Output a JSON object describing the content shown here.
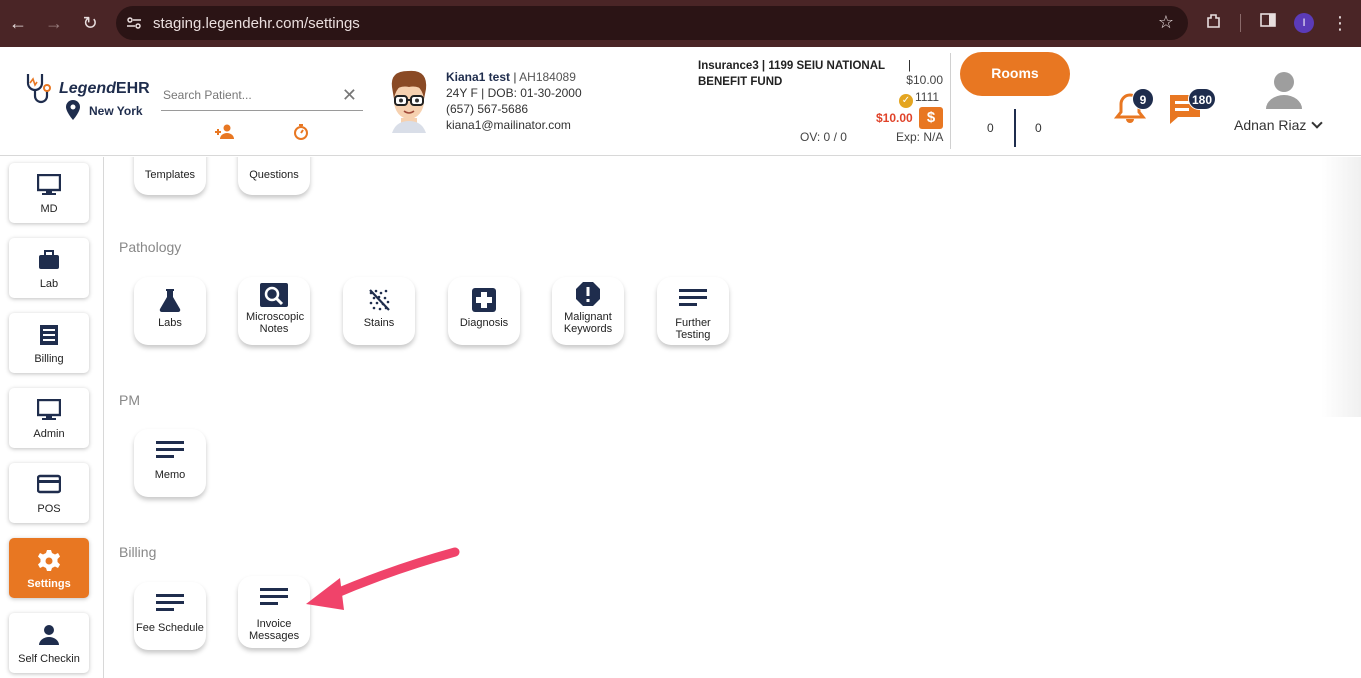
{
  "browser": {
    "url": "staging.legendehr.com/settings",
    "profile_initial": "I"
  },
  "header": {
    "brand": "LegendEHR",
    "brand_a": "Legend",
    "brand_b": "EHR",
    "location": "New York",
    "search_placeholder": "Search Patient...",
    "patient": {
      "name": "Kiana1 test",
      "id": "AH184089",
      "line2": "24Y F | DOB: 01-30-2000",
      "phone": "(657) 567-5686",
      "email": "kiana1@mailinator.com"
    },
    "insurance": {
      "line1": "Insurance3 | 1199 SEIU NATIONAL",
      "line2": "BENEFIT FUND",
      "pipe": "|"
    },
    "balance": "$10.00",
    "coins": "1111",
    "due": "$10.00",
    "dollar_sign": "$",
    "ov": "OV: 0 / 0",
    "exp": "Exp: N/A",
    "rooms_label": "Rooms",
    "count_left": "0",
    "count_right": "0",
    "notifications": "9",
    "messages": "180",
    "user_name": "Adnan Riaz"
  },
  "sidebar": {
    "items": [
      {
        "label": "MD"
      },
      {
        "label": "Lab"
      },
      {
        "label": "Billing"
      },
      {
        "label": "Admin"
      },
      {
        "label": "POS"
      },
      {
        "label": "Settings"
      },
      {
        "label": "Self Checkin"
      }
    ]
  },
  "main": {
    "top_cards": [
      "Templates",
      "Questions"
    ],
    "pathology": {
      "title": "Pathology",
      "cards": [
        "Labs",
        "Microscopic Notes",
        "Stains",
        "Diagnosis",
        "Malignant Keywords",
        "Further Testing"
      ]
    },
    "pm": {
      "title": "PM",
      "cards": [
        "Memo"
      ]
    },
    "billing": {
      "title": "Billing",
      "cards": [
        "Fee Schedule",
        "Invoice Messages"
      ]
    }
  },
  "colors": {
    "accent": "#e87722",
    "navy": "#1f2d4d",
    "chrome": "#4a2526",
    "annotation_arrow": "#f0436a"
  }
}
